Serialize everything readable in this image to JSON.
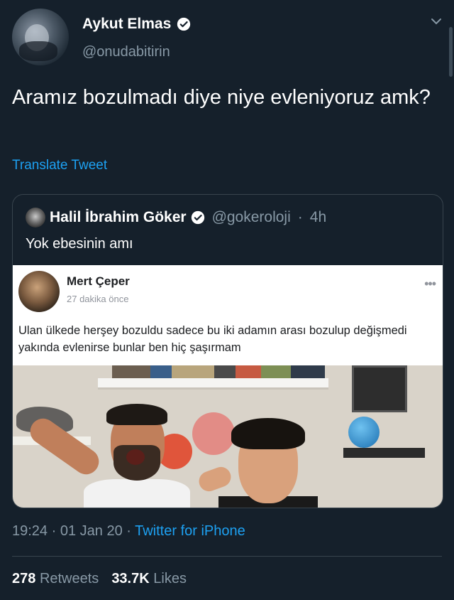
{
  "tweet": {
    "author_name": "Aykut Elmas",
    "author_handle": "@onudabitirin",
    "text": "Aramız bozulmadı diye niye evleniyoruz amk?",
    "translate_label": "Translate Tweet",
    "time": "19:24",
    "date": "01 Jan 20",
    "source": "Twitter for iPhone",
    "retweets_count": "278",
    "retweets_label": "Retweets",
    "likes_count": "33.7K",
    "likes_label": "Likes"
  },
  "quoted": {
    "author_name": "Halil İbrahim Göker",
    "author_handle": "@gokeroloji",
    "age": "4h",
    "text": "Yok ebesinin amı"
  },
  "facebook_post": {
    "author_name": "Mert Çeper",
    "time": "27 dakika önce",
    "more_icon": "more-dots-icon",
    "text": "Ulan ülkede herşey bozuldu sadece bu iki adamın arası bozulup değişmedi yakında evlenirse bunlar ben hiç şaşırmam"
  },
  "icons": {
    "verified": "verified-badge-icon",
    "chevron": "chevron-down-icon"
  },
  "colors": {
    "background": "#15202b",
    "accent": "#1da1f2",
    "muted": "#8899a6",
    "border": "#38444d"
  }
}
